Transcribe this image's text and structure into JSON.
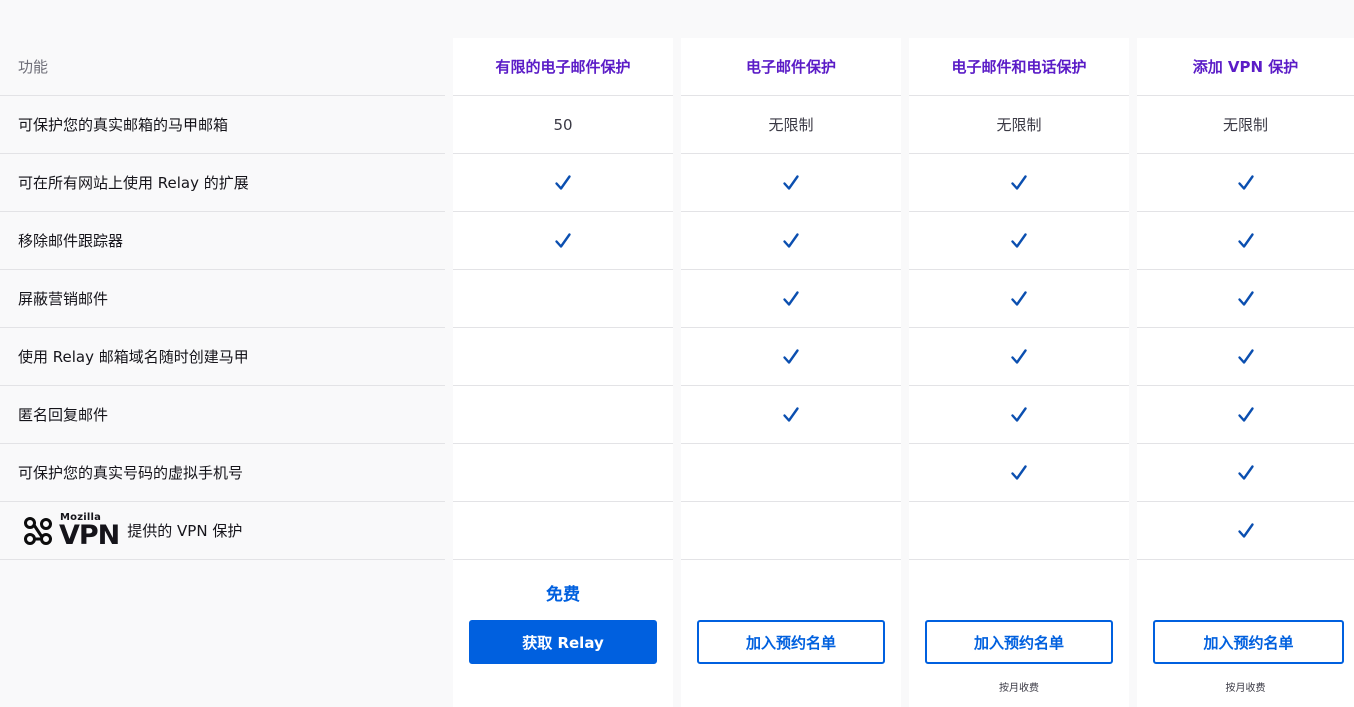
{
  "header_label": "功能",
  "plans": [
    {
      "title": "有限的电子邮件保护",
      "price": "免费",
      "button": "获取 Relay",
      "button_style": "primary",
      "note": ""
    },
    {
      "title": "电子邮件保护",
      "price": "",
      "button": "加入预约名单",
      "button_style": "outline",
      "note": ""
    },
    {
      "title": "电子邮件和电话保护",
      "price": "",
      "button": "加入预约名单",
      "button_style": "outline",
      "note": "按月收费"
    },
    {
      "title": "添加 VPN 保护",
      "price": "",
      "button": "加入预约名单",
      "button_style": "outline",
      "note": "按月收费"
    }
  ],
  "features": [
    {
      "label": "可保护您的真实邮箱的马甲邮箱",
      "values": [
        "50",
        "无限制",
        "无限制",
        "无限制"
      ]
    },
    {
      "label": "可在所有网站上使用 Relay 的扩展",
      "values": [
        true,
        true,
        true,
        true
      ]
    },
    {
      "label": "移除邮件跟踪器",
      "values": [
        true,
        true,
        true,
        true
      ]
    },
    {
      "label": "屏蔽营销邮件",
      "values": [
        false,
        true,
        true,
        true
      ]
    },
    {
      "label": "使用 Relay 邮箱域名随时创建马甲",
      "values": [
        false,
        true,
        true,
        true
      ]
    },
    {
      "label": "匿名回复邮件",
      "values": [
        false,
        true,
        true,
        true
      ]
    },
    {
      "label": "可保护您的真实号码的虚拟手机号",
      "values": [
        false,
        false,
        true,
        true
      ]
    },
    {
      "label": "提供的 VPN 保护",
      "logo": {
        "brand_top": "Mozilla",
        "brand_main": "VPN"
      },
      "values": [
        false,
        false,
        false,
        true
      ]
    }
  ],
  "colors": {
    "accent": "#0060df",
    "heading": "#5b1cc7",
    "check": "#0b4fb0"
  },
  "icons": {
    "check": "check-icon",
    "vpn_logo": "mozilla-vpn-logo-icon"
  }
}
